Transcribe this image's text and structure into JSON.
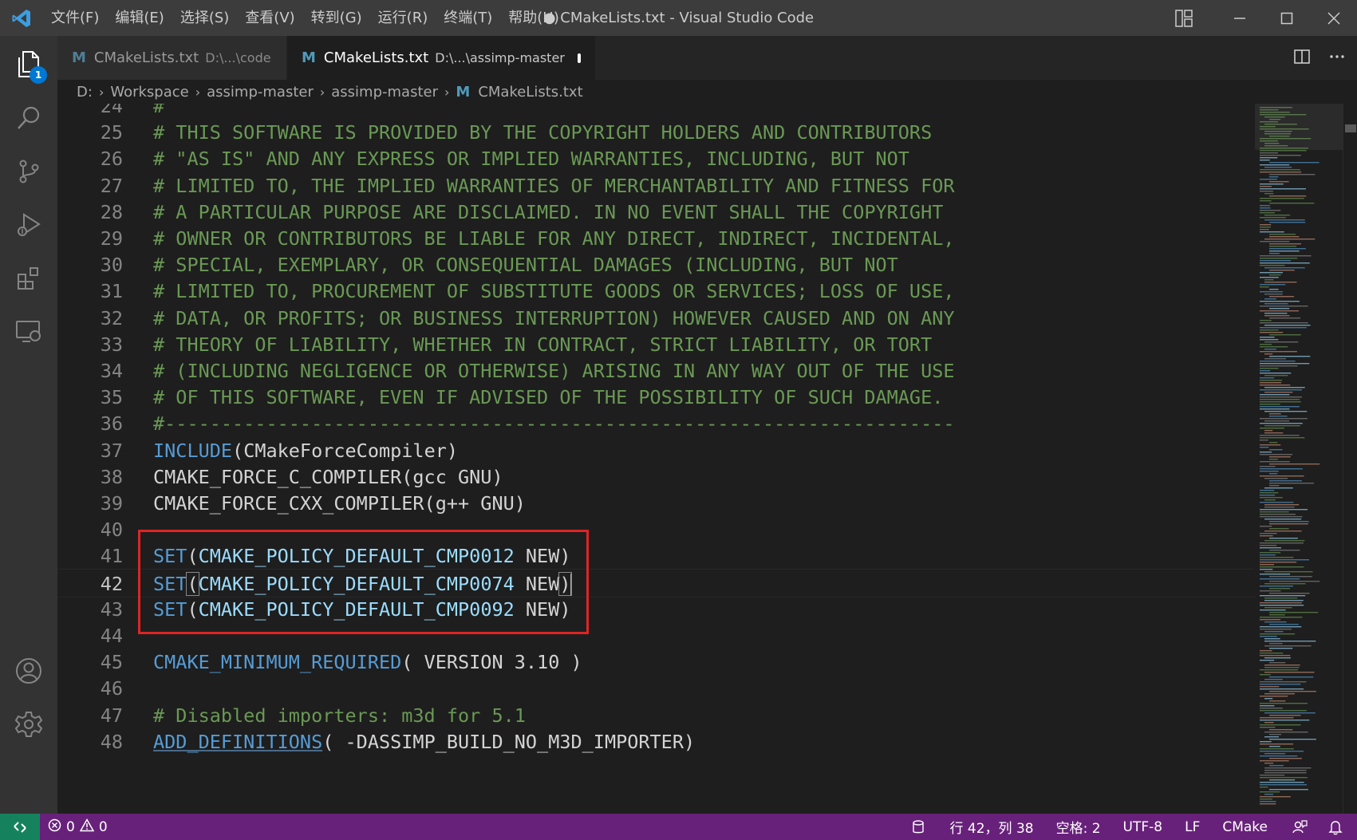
{
  "window": {
    "title": "● CMakeLists.txt - Visual Studio Code",
    "menu": [
      "文件(F)",
      "编辑(E)",
      "选择(S)",
      "查看(V)",
      "转到(G)",
      "运行(R)",
      "终端(T)",
      "帮助(H)"
    ]
  },
  "activity_bar": {
    "explorer_badge": "1",
    "items": [
      "explorer-icon",
      "search-icon",
      "source-control-icon",
      "run-debug-icon",
      "extensions-icon",
      "remote-explorer-icon",
      "accounts-icon",
      "settings-gear-icon"
    ]
  },
  "tabs": [
    {
      "icon": "M",
      "label": "CMakeLists.txt",
      "description": "D:\\...\\code",
      "active": false
    },
    {
      "icon": "M",
      "label": "CMakeLists.txt",
      "description": "D:\\...\\assimp-master",
      "active": true,
      "dirty": true
    }
  ],
  "breadcrumb": {
    "items": [
      "D:",
      "Workspace",
      "assimp-master",
      "assimp-master"
    ],
    "file_icon": "M",
    "file": "CMakeLists.txt"
  },
  "editor": {
    "current_line": "42",
    "lines": [
      {
        "n": "24",
        "segments": [
          {
            "t": "#",
            "c": "cm"
          }
        ]
      },
      {
        "n": "25",
        "segments": [
          {
            "t": "# THIS SOFTWARE IS PROVIDED BY THE COPYRIGHT HOLDERS AND CONTRIBUTORS",
            "c": "cm"
          }
        ]
      },
      {
        "n": "26",
        "segments": [
          {
            "t": "# \"AS IS\" AND ANY EXPRESS OR IMPLIED WARRANTIES, INCLUDING, BUT NOT",
            "c": "cm"
          }
        ]
      },
      {
        "n": "27",
        "segments": [
          {
            "t": "# LIMITED TO, THE IMPLIED WARRANTIES OF MERCHANTABILITY AND FITNESS FOR",
            "c": "cm"
          }
        ]
      },
      {
        "n": "28",
        "segments": [
          {
            "t": "# A PARTICULAR PURPOSE ARE DISCLAIMED. IN NO EVENT SHALL THE COPYRIGHT",
            "c": "cm"
          }
        ]
      },
      {
        "n": "29",
        "segments": [
          {
            "t": "# OWNER OR CONTRIBUTORS BE LIABLE FOR ANY DIRECT, INDIRECT, INCIDENTAL,",
            "c": "cm"
          }
        ]
      },
      {
        "n": "30",
        "segments": [
          {
            "t": "# SPECIAL, EXEMPLARY, OR CONSEQUENTIAL DAMAGES (INCLUDING, BUT NOT",
            "c": "cm"
          }
        ]
      },
      {
        "n": "31",
        "segments": [
          {
            "t": "# LIMITED TO, PROCUREMENT OF SUBSTITUTE GOODS OR SERVICES; LOSS OF USE,",
            "c": "cm"
          }
        ]
      },
      {
        "n": "32",
        "segments": [
          {
            "t": "# DATA, OR PROFITS; OR BUSINESS INTERRUPTION) HOWEVER CAUSED AND ON ANY",
            "c": "cm"
          }
        ]
      },
      {
        "n": "33",
        "segments": [
          {
            "t": "# THEORY OF LIABILITY, WHETHER IN CONTRACT, STRICT LIABILITY, OR TORT",
            "c": "cm"
          }
        ]
      },
      {
        "n": "34",
        "segments": [
          {
            "t": "# (INCLUDING NEGLIGENCE OR OTHERWISE) ARISING IN ANY WAY OUT OF THE USE",
            "c": "cm"
          }
        ]
      },
      {
        "n": "35",
        "segments": [
          {
            "t": "# OF THIS SOFTWARE, EVEN IF ADVISED OF THE POSSIBILITY OF SUCH DAMAGE.",
            "c": "cm"
          }
        ]
      },
      {
        "n": "36",
        "segments": [
          {
            "t": "#----------------------------------------------------------------------",
            "c": "cm"
          }
        ]
      },
      {
        "n": "37",
        "segments": [
          {
            "t": "INCLUDE",
            "c": "fn"
          },
          {
            "t": "(CMakeForceCompiler)",
            "c": "plain"
          }
        ]
      },
      {
        "n": "38",
        "segments": [
          {
            "t": "CMAKE_FORCE_C_COMPILER(gcc GNU)",
            "c": "plain"
          }
        ]
      },
      {
        "n": "39",
        "segments": [
          {
            "t": "CMAKE_FORCE_CXX_COMPILER(g++ GNU)",
            "c": "plain"
          }
        ]
      },
      {
        "n": "40",
        "segments": []
      },
      {
        "n": "41",
        "segments": [
          {
            "t": "SET",
            "c": "fn"
          },
          {
            "t": "(",
            "c": "plain"
          },
          {
            "t": "CMAKE_POLICY_DEFAULT_CMP0012",
            "c": "var"
          },
          {
            "t": " NEW)",
            "c": "plain"
          }
        ]
      },
      {
        "n": "42",
        "segments": [
          {
            "t": "SET",
            "c": "fn"
          },
          {
            "t": "(",
            "c": "plain bracket"
          },
          {
            "t": "CMAKE_POLICY_DEFAULT_CMP0074",
            "c": "var"
          },
          {
            "t": " NEW",
            "c": "plain"
          },
          {
            "t": ")",
            "c": "plain bracket"
          }
        ]
      },
      {
        "n": "43",
        "segments": [
          {
            "t": "SET",
            "c": "fn"
          },
          {
            "t": "(",
            "c": "plain"
          },
          {
            "t": "CMAKE_POLICY_DEFAULT_CMP0092",
            "c": "var"
          },
          {
            "t": " NEW)",
            "c": "plain"
          }
        ]
      },
      {
        "n": "44",
        "segments": []
      },
      {
        "n": "45",
        "segments": [
          {
            "t": "CMAKE_MINIMUM_REQUIRED",
            "c": "fn"
          },
          {
            "t": "( VERSION ",
            "c": "plain"
          },
          {
            "t": "3.10",
            "c": "num"
          },
          {
            "t": " )",
            "c": "plain"
          }
        ]
      },
      {
        "n": "46",
        "segments": []
      },
      {
        "n": "47",
        "segments": [
          {
            "t": "# Disabled importers: m3d for 5.1",
            "c": "cm"
          }
        ]
      },
      {
        "n": "48",
        "segments": [
          {
            "t": "ADD_DEFINITIONS",
            "c": "fn ul"
          },
          {
            "t": "( -DASSIMP_BUILD_NO_M3D_IMPORTER)",
            "c": "plain"
          }
        ]
      }
    ]
  },
  "statusbar": {
    "errors": "0",
    "warnings": "0",
    "cursor_position": "行 42，列 38",
    "indentation": "空格: 2",
    "encoding": "UTF-8",
    "eol": "LF",
    "language": "CMake"
  },
  "colors": {
    "statusbar": "#68217a",
    "remote": "#16825d",
    "highlight_box": "#e02424",
    "comment": "#6a9955",
    "keyword": "#569cd6",
    "variable": "#9cdcfe"
  }
}
